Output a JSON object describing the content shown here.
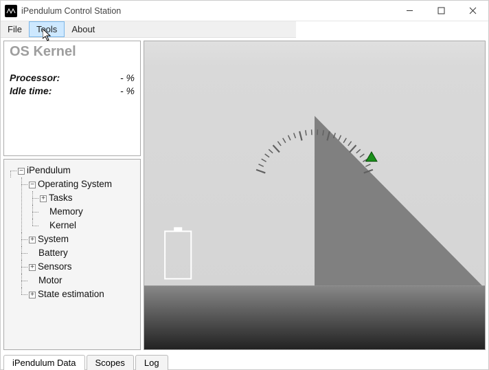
{
  "window": {
    "title": "iPendulum Control Station"
  },
  "menubar": {
    "items": [
      "File",
      "Tools",
      "About"
    ],
    "highlighted": "Tools"
  },
  "kernel_panel": {
    "title": "OS Kernel",
    "rows": [
      {
        "label": "Processor:",
        "value": "- %"
      },
      {
        "label": "Idle time:",
        "value": "- %"
      }
    ]
  },
  "tree": {
    "root": {
      "label": "iPendulum",
      "expanded": true,
      "children": [
        {
          "label": "Operating System",
          "expanded": true,
          "children": [
            {
              "label": "Tasks",
              "expandable": true
            },
            {
              "label": "Memory"
            },
            {
              "label": "Kernel"
            }
          ]
        },
        {
          "label": "System",
          "expandable": true
        },
        {
          "label": "Battery"
        },
        {
          "label": "Sensors",
          "expandable": true
        },
        {
          "label": "Motor"
        },
        {
          "label": "State estimation",
          "expandable": true
        }
      ]
    }
  },
  "tabs": {
    "items": [
      "iPendulum Data",
      "Scopes",
      "Log"
    ],
    "active": "iPendulum Data"
  },
  "chart_data": {
    "type": "gauge",
    "title": "",
    "needle_angle_deg": 60,
    "major_ticks": 5,
    "minor_ticks_per_segment": 5,
    "range_deg": [
      -70,
      70
    ],
    "battery_level_pct": 0
  }
}
